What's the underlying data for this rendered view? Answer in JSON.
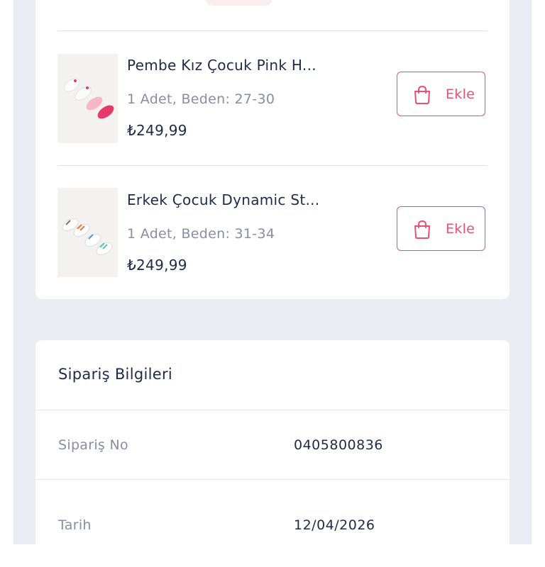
{
  "items": [
    {
      "name": "Pembe Kız Çocuk Pink H...",
      "meta": "1 Adet, Beden: 27-30",
      "price": "₺249,99",
      "button_label": "Ekle",
      "sock_colors": [
        "#f4f0ee",
        "#f1ecea",
        "#f6b7c8",
        "#e53a6c"
      ]
    },
    {
      "name": "Erkek Çocuk Dynamic St...",
      "meta": "1 Adet, Beden: 31-34",
      "price": "₺249,99",
      "button_label": "Ekle",
      "sock_colors": [
        "#f4f4f4",
        "#f4f4f4",
        "#f4f4f4",
        "#f4f4f4"
      ]
    }
  ],
  "order_info": {
    "title": "Sipariş Bilgileri",
    "rows": [
      {
        "label": "Sipariş No",
        "value": "0405800836"
      },
      {
        "label": "Tarih",
        "value": "12/04/2026"
      }
    ]
  },
  "colors": {
    "accent": "#e8516f",
    "page_bg": "#ececf4",
    "card_bg": "#ffffff",
    "text_primary": "#1f2a48",
    "text_secondary": "#8a8ca2"
  }
}
